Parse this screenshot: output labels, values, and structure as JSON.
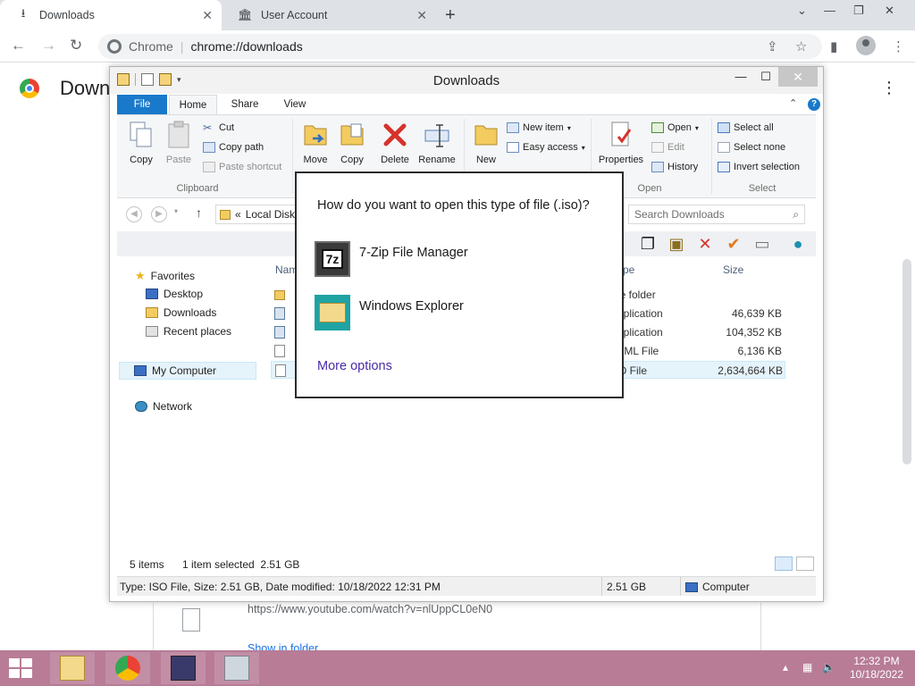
{
  "browser": {
    "tabs": [
      {
        "title": "Downloads",
        "active": true
      },
      {
        "title": "User Account",
        "active": false
      }
    ],
    "site_name": "Chrome",
    "url": "chrome://downloads",
    "page_title": "Down",
    "download_url": "https://www.youtube.com/watch?v=nlUppCL0eN0",
    "show_in_folder": "Show in folder"
  },
  "explorer": {
    "title": "Downloads",
    "tabs": [
      "File",
      "Home",
      "Share",
      "View"
    ],
    "ribbon": {
      "clipboard": {
        "copy": "Copy",
        "paste": "Paste",
        "cut": "Cut",
        "copy_path": "Copy path",
        "paste_shortcut": "Paste shortcut",
        "label": "Clipboard"
      },
      "organize": {
        "move_to": "Move to",
        "copy_to": "Copy to",
        "delete": "Delete",
        "rename": "Rename"
      },
      "new": {
        "new_folder": "New folder",
        "new_item": "New item",
        "easy_access": "Easy access"
      },
      "open": {
        "properties": "Properties",
        "open": "Open",
        "edit": "Edit",
        "history": "History",
        "label": "Open"
      },
      "select": {
        "select_all": "Select all",
        "select_none": "Select none",
        "invert": "Invert selection",
        "label": "Select"
      }
    },
    "address": "Local Disk",
    "address_prefix": "«",
    "search_placeholder": "Search Downloads",
    "nav": {
      "favorites": "Favorites",
      "desktop": "Desktop",
      "downloads": "Downloads",
      "recent": "Recent places",
      "my_computer": "My Computer",
      "network": "Network"
    },
    "columns": {
      "name": "Nam",
      "type": "ype",
      "size": "Size"
    },
    "files": [
      {
        "type": "le folder",
        "size": ""
      },
      {
        "type": "pplication",
        "size": "46,639 KB"
      },
      {
        "type": "pplication",
        "size": "104,352 KB"
      },
      {
        "type": "TML File",
        "size": "6,136 KB"
      },
      {
        "type": "O File",
        "size": "2,634,664 KB"
      }
    ],
    "status": {
      "items": "5 items",
      "selected": "1 item selected  2.51 GB"
    },
    "details": {
      "info": "Type: ISO File, Size: 2.51 GB, Date modified: 10/18/2022 12:31 PM",
      "size": "2.51 GB",
      "location": "Computer"
    }
  },
  "dialog": {
    "question": "How do you want to open this type of file (.iso)?",
    "options": [
      "7-Zip File Manager",
      "Windows Explorer"
    ],
    "more": "More options"
  },
  "taskbar": {
    "time": "12:32 PM",
    "date": "10/18/2022"
  }
}
